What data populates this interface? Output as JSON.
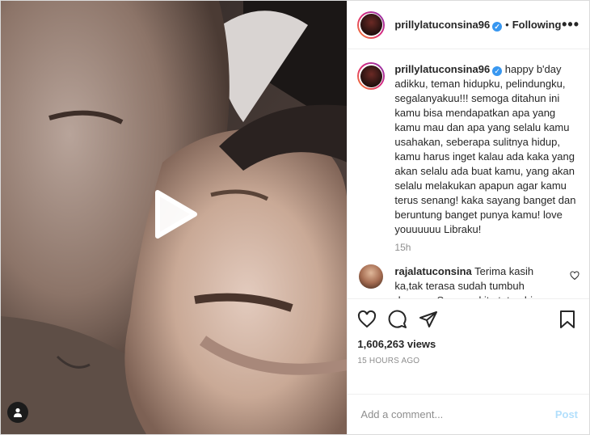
{
  "post": {
    "username": "prillylatuconsina96",
    "follow_status": "Following",
    "more_icon": "ellipsis-icon",
    "caption": "happy b'day adikku, teman hidupku, pelindungku, segalanyakuu!!! semoga ditahun ini kamu bisa mendapatkan apa yang kamu mau dan apa yang selalu kamu usahakan, seberapa sulitnya hidup, kamu harus inget kalau ada kaka yang akan selalu ada buat kamu, yang akan selalu melakukan apapun agar kamu terus senang! kaka sayang banget dan beruntung banget punya kamu! love youuuuuu Libraku!",
    "caption_time": "15h",
    "views": "1,606,263 views",
    "time_ago": "15 HOURS AGO"
  },
  "comments": [
    {
      "username": "rajalatuconsina",
      "text": "Terima kasih ka,tak terasa sudah tumbuh dewasa. Semoga kita tetep bisa manjat pohon jambu tetangga ya!"
    }
  ],
  "add_comment": {
    "placeholder": "Add a comment...",
    "post_label": "Post"
  },
  "colors": {
    "verified": "#3897f0",
    "post_button": "#b2dffc",
    "muted": "#8e8e8e"
  }
}
